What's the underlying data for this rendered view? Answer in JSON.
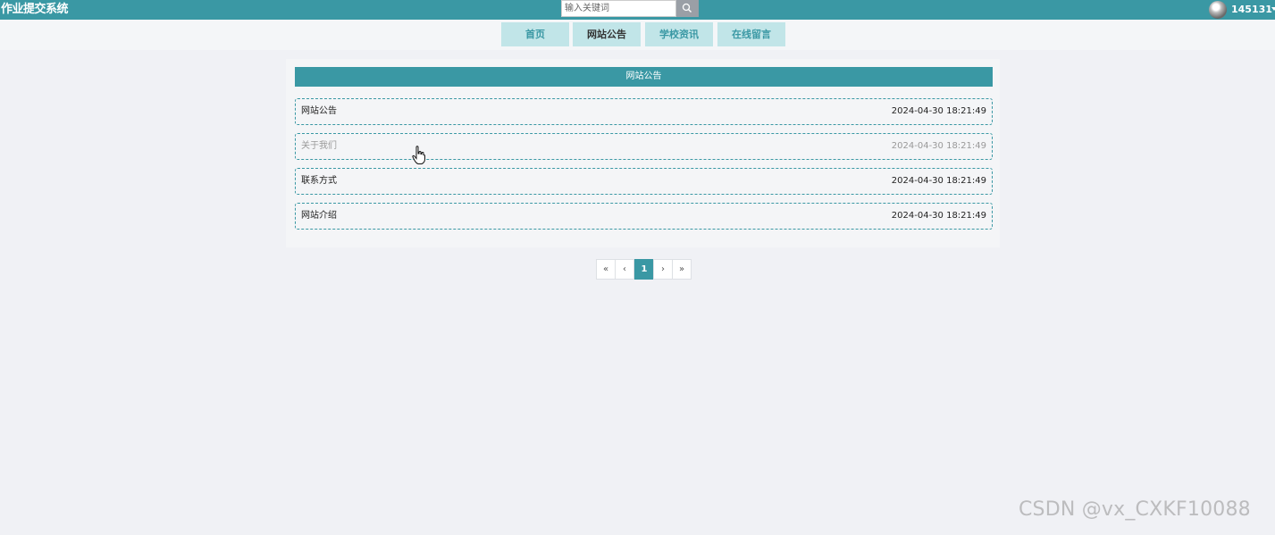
{
  "header": {
    "app_title": "作业提交系统",
    "search_placeholder": "输入关键词",
    "search_icon": "search-icon",
    "username": "145131",
    "colors": {
      "header_bg": "#3a98a4",
      "nav_bg": "#c1e5e8"
    }
  },
  "nav": {
    "items": [
      {
        "label": "首页"
      },
      {
        "label": "网站公告",
        "active": true
      },
      {
        "label": "学校资讯"
      },
      {
        "label": "在线留言"
      }
    ]
  },
  "panel": {
    "title": "网站公告",
    "items": [
      {
        "title": "网站公告",
        "date": "2024-04-30 18:21:49"
      },
      {
        "title": "关于我们",
        "date": "2024-04-30 18:21:49"
      },
      {
        "title": "联系方式",
        "date": "2024-04-30 18:21:49"
      },
      {
        "title": "网站介绍",
        "date": "2024-04-30 18:21:49"
      }
    ]
  },
  "pagination": {
    "first": "«",
    "prev": "‹",
    "current": "1",
    "next": "›",
    "last": "»"
  },
  "watermark": "CSDN @vx_CXKF10088"
}
